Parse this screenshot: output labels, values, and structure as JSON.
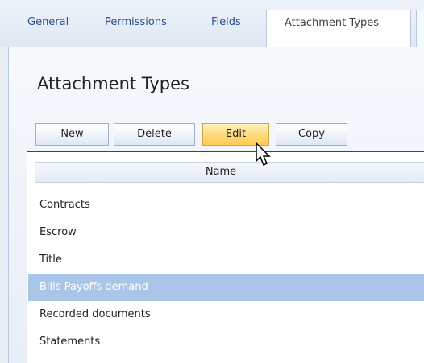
{
  "tabs": [
    {
      "label": "General",
      "active": false
    },
    {
      "label": "Permissions",
      "active": false
    },
    {
      "label": "Fields",
      "active": false
    },
    {
      "label": "Attachment Types",
      "active": true
    }
  ],
  "page": {
    "title": "Attachment Types"
  },
  "toolbar": {
    "new_label": "New",
    "delete_label": "Delete",
    "edit_label": "Edit",
    "copy_label": "Copy"
  },
  "grid": {
    "columns": [
      "Name"
    ],
    "rows": [
      {
        "name": "Contracts",
        "selected": false
      },
      {
        "name": "Escrow",
        "selected": false
      },
      {
        "name": "Title",
        "selected": false
      },
      {
        "name": "Bills Payoffs demand",
        "selected": true
      },
      {
        "name": "Recorded documents",
        "selected": false
      },
      {
        "name": "Statements",
        "selected": false
      }
    ]
  },
  "colors": {
    "accent_tab_text": "#2c4f8f",
    "edit_button_highlight": "#ffd978",
    "selected_row": "#a9c5e8",
    "panel_background": "#eef3f9"
  },
  "icons": {
    "cursor": "mouse-pointer-icon"
  }
}
